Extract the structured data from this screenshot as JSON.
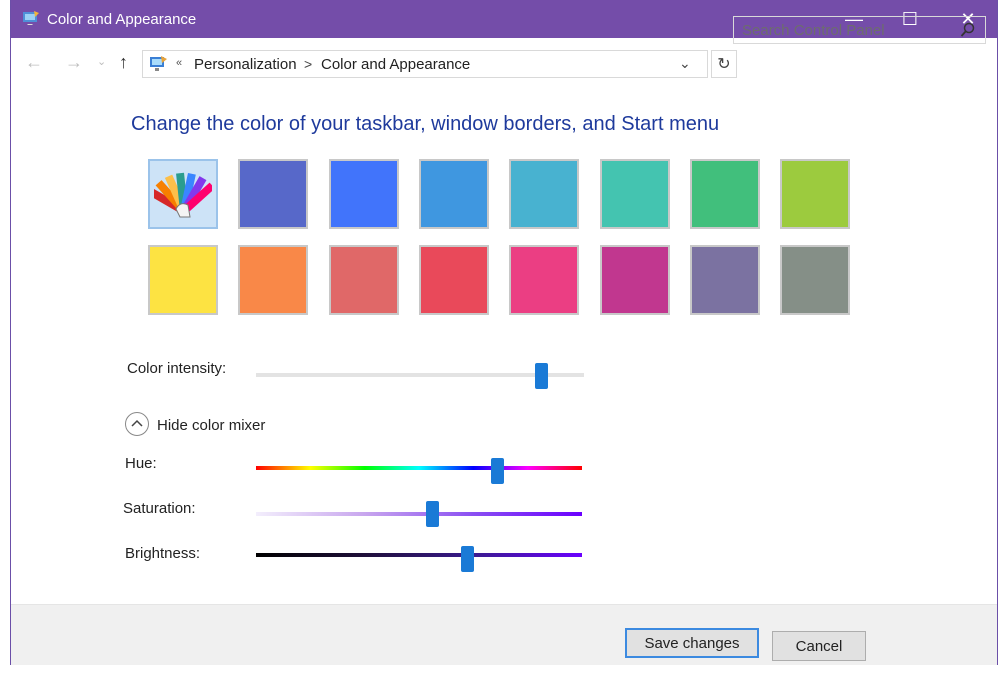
{
  "window": {
    "title": "Color and Appearance",
    "controls": {
      "minimize": "—",
      "maximize": "☐",
      "close": "✕"
    }
  },
  "nav": {
    "back": "←",
    "forward": "→",
    "recent": "⌄",
    "up": "↑"
  },
  "address": {
    "overflow": "«",
    "crumbs": [
      "Personalization",
      "Color and Appearance"
    ],
    "separator": ">",
    "dropdown": "⌄",
    "refresh": "↻"
  },
  "search": {
    "placeholder": "Search Control Panel"
  },
  "main": {
    "heading": "Change the color of your taskbar, window borders, and Start menu",
    "swatches": [
      "#5768c9",
      "#4174fb",
      "#3f97e0",
      "#48b2d0",
      "#44c4b0",
      "#41bf7c",
      "#9ccb3e",
      "#fde342",
      "#f98848",
      "#e06868",
      "#e9495a",
      "#eb3e83",
      "#c1378f",
      "#7b72a1",
      "#858f87"
    ],
    "color_intensity": {
      "label": "Color intensity:",
      "value": 0.87
    },
    "mixer_toggle": "Hide color mixer",
    "hue": {
      "label": "Hue:",
      "value": 0.74
    },
    "saturation": {
      "label": "Saturation:",
      "value": 0.54
    },
    "brightness": {
      "label": "Brightness:",
      "value": 0.65
    }
  },
  "footer": {
    "save": "Save changes",
    "cancel": "Cancel"
  },
  "colors": {
    "titlebar": "#744da9",
    "accent": "#1a7ad6",
    "heading": "#1e3a9c"
  }
}
